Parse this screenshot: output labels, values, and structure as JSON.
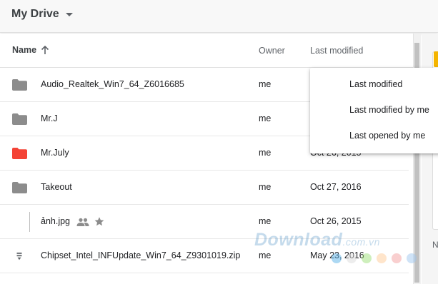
{
  "topbar": {
    "title": "My Drive",
    "dropdown_icon": "caret-down-icon"
  },
  "columns": {
    "name": "Name",
    "owner": "Owner",
    "last_modified": "Last modified",
    "sort_icon": "arrow-up-icon"
  },
  "files": [
    {
      "name": "Audio_Realtek_Win7_64_Z6016685",
      "owner": "me",
      "modified": "",
      "icon": "folder-icon",
      "color": "#8c8c8c"
    },
    {
      "name": "Mr.J",
      "owner": "me",
      "modified": "",
      "icon": "folder-icon",
      "color": "#8c8c8c"
    },
    {
      "name": "Mr.July",
      "owner": "me",
      "modified": "Oct 26, 2015",
      "icon": "folder-icon",
      "color": "#f44336"
    },
    {
      "name": "Takeout",
      "owner": "me",
      "modified": "Oct 27, 2016",
      "icon": "folder-icon",
      "color": "#8c8c8c"
    },
    {
      "name": "ảnh.jpg",
      "owner": "me",
      "modified": "Oct 26, 2015",
      "icon": "image-icon",
      "shared_icon": "people-icon",
      "star_icon": "star-icon"
    },
    {
      "name": "Chipset_Intel_INFUpdate_Win7_64_Z9301019.zip",
      "owner": "me",
      "modified": "May 23, 2016",
      "icon": "zip-icon",
      "color": "#5f6368"
    }
  ],
  "sort_menu": {
    "items": [
      "Last modified",
      "Last modified by me",
      "Last opened by me"
    ]
  },
  "side_panel": {
    "label": "N",
    "accent": "#f4b400"
  },
  "watermark": {
    "text": "Download",
    "suffix": ".com.vn",
    "dot_colors": [
      "#5ab1e8",
      "#e8e8e8",
      "#9ee07a",
      "#ffd0a0",
      "#f4a0a0",
      "#a0c8f0"
    ]
  }
}
